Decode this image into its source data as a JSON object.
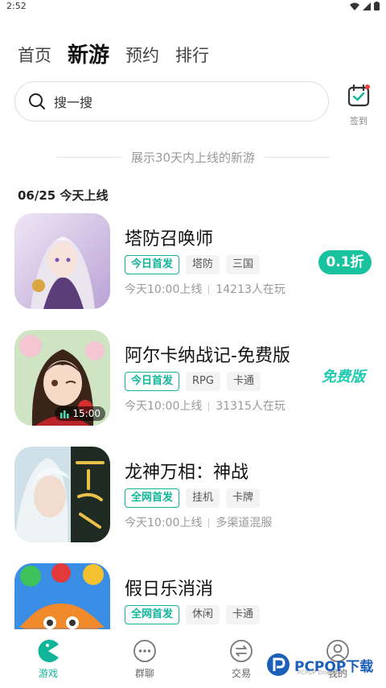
{
  "status_bar": {
    "time": "2:52"
  },
  "tabs": [
    {
      "label": "首页",
      "active": false
    },
    {
      "label": "新游",
      "active": true
    },
    {
      "label": "预约",
      "active": false
    },
    {
      "label": "排行",
      "active": false
    }
  ],
  "search": {
    "placeholder": "搜一搜"
  },
  "signin": {
    "label": "签到"
  },
  "section": {
    "divider_text": "展示30天内上线的新游",
    "date_heading": "06/25 今天上线"
  },
  "games": [
    {
      "name": "塔防召唤师",
      "tags": [
        "今日首发",
        "塔防",
        "三国"
      ],
      "time": "今天10:00上线",
      "extra": "14213人在玩",
      "badge": "0.1折"
    },
    {
      "name": "阿尔卡纳战记-免费版",
      "tags": [
        "今日首发",
        "RPG",
        "卡通"
      ],
      "time": "今天10:00上线",
      "extra": "31315人在玩",
      "badge": "免费版",
      "video_duration": "15:00"
    },
    {
      "name": "龙神万相：神战",
      "tags": [
        "全网首发",
        "挂机",
        "卡牌"
      ],
      "time": "今天10:00上线",
      "extra": "多渠道混服"
    },
    {
      "name": "假日乐消消",
      "tags": [
        "全网首发",
        "休闲",
        "卡通"
      ]
    }
  ],
  "bottom_nav": [
    {
      "label": "游戏",
      "icon": "pacman-icon",
      "active": true
    },
    {
      "label": "群聊",
      "icon": "chat-dots-icon",
      "active": false
    },
    {
      "label": "交易",
      "icon": "exchange-icon",
      "active": false
    },
    {
      "label": "我的",
      "icon": "profile-icon",
      "active": false
    }
  ],
  "watermark": {
    "text": "PCPOP下载",
    "sub": "PCPOP Download"
  },
  "colors": {
    "accent": "#11b59a",
    "badge_bg": "#19c3a0"
  }
}
